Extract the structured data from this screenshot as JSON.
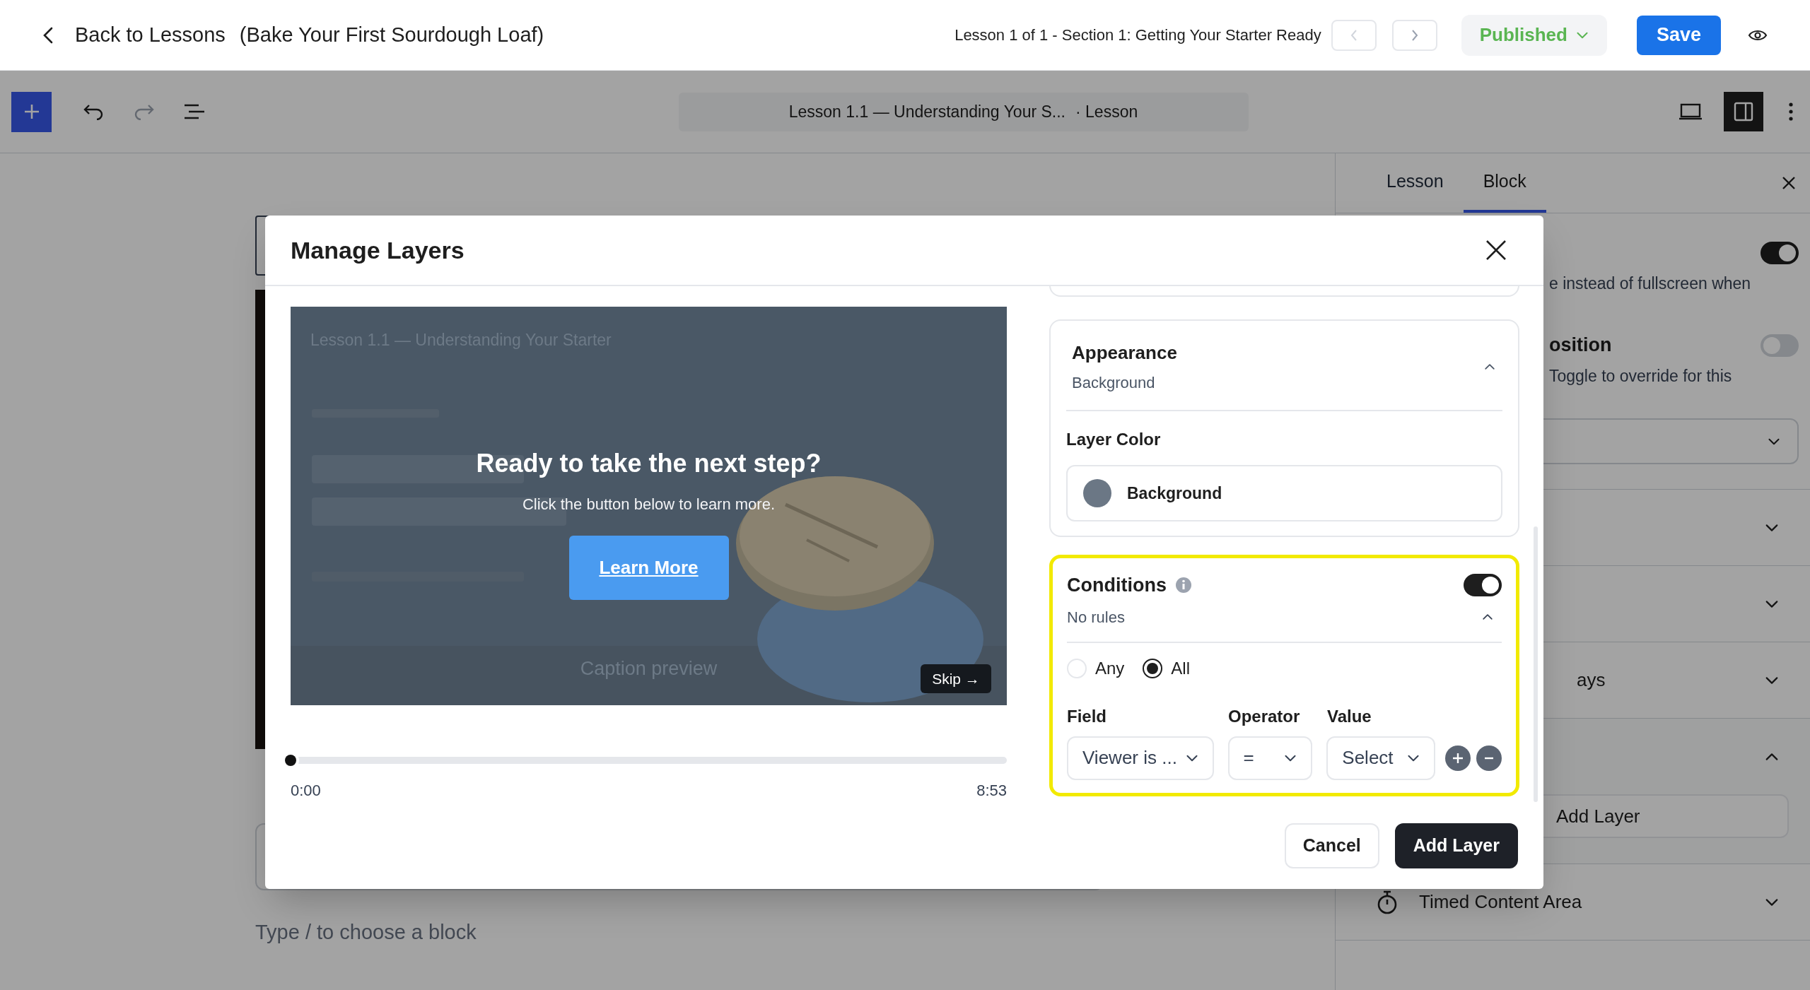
{
  "header": {
    "back_label": "Back to Lessons",
    "course": "(Bake Your First Sourdough Loaf)",
    "breadcrumb": "Lesson 1 of 1 - Section 1: Getting Your Starter Ready",
    "status": "Published",
    "save": "Save"
  },
  "toolbar": {
    "document_title": "Lesson 1.1 — Understanding Your S...",
    "document_type": "· Lesson",
    "sidebar_open": true
  },
  "canvas": {
    "placeholder": "Type / to choose a block"
  },
  "sidebar": {
    "tabs": [
      {
        "label": "Lesson",
        "selected": false
      },
      {
        "label": "Block",
        "selected": true
      }
    ],
    "settings": [
      {
        "kind": "toggle",
        "description": "e instead of fullscreen when",
        "on": true
      },
      {
        "kind": "toggle",
        "label": "osition",
        "description": "Toggle to override for this",
        "on": false
      },
      {
        "kind": "select"
      }
    ],
    "panels": [
      {
        "expanded": false
      },
      {
        "expanded": false
      },
      {
        "title": "ays",
        "expanded": false
      },
      {
        "expanded": true,
        "button": "Add Layer"
      },
      {
        "title": "Timed Content Area",
        "expanded": false
      }
    ]
  },
  "modal": {
    "title": "Manage Layers",
    "preview": {
      "video_title": "Lesson 1.1 — Understanding Your Starter",
      "heading": "Ready to take the next step?",
      "text": "Click the button below to learn more.",
      "button": "Learn More",
      "caption": "Caption preview",
      "skip": "Skip →",
      "level": 0,
      "current_time": "0:00",
      "duration": "8:53"
    },
    "appearance": {
      "title": "Appearance",
      "subtitle": "Background",
      "expanded": true,
      "layer_color_label": "Layer Color",
      "layer_color": {
        "name": "Background",
        "color": "#6b7785"
      }
    },
    "conditions": {
      "title": "Conditions",
      "on": true,
      "summary": "No rules",
      "expanded": true,
      "match": [
        {
          "label": "Any",
          "selected": false
        },
        {
          "label": "All",
          "selected": true
        }
      ],
      "columns": [
        "Field",
        "Operator",
        "Value"
      ],
      "rule": {
        "field": "Viewer is ...",
        "operator": "=",
        "value": "Select"
      }
    },
    "buttons": [
      {
        "label": "Cancel",
        "kind": "secondary"
      },
      {
        "label": "Add Layer",
        "kind": "primary"
      }
    ]
  }
}
